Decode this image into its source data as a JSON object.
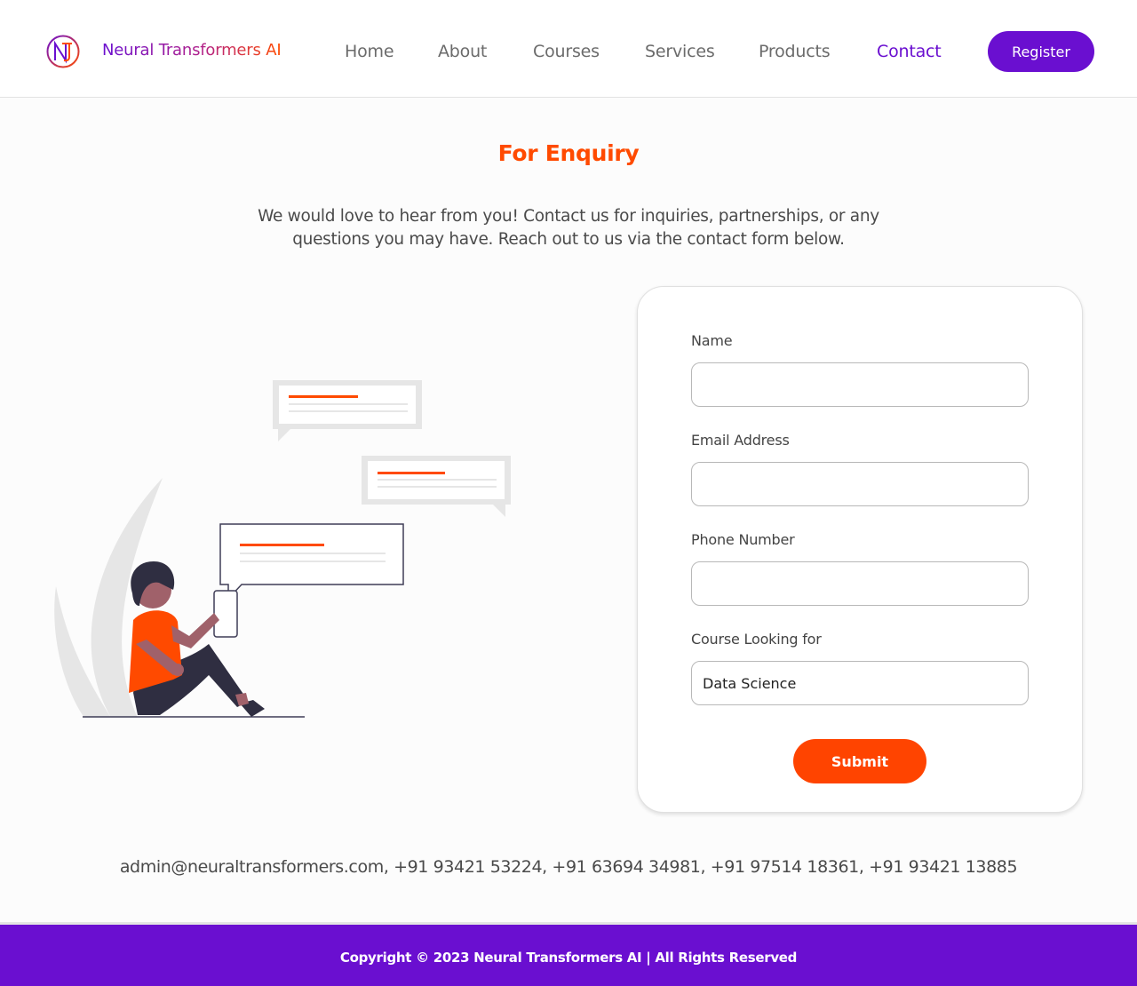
{
  "header": {
    "brand": "Neural Transformers AI",
    "nav": [
      {
        "label": "Home"
      },
      {
        "label": "About"
      },
      {
        "label": "Courses"
      },
      {
        "label": "Services"
      },
      {
        "label": "Products"
      },
      {
        "label": "Contact",
        "active": true
      }
    ],
    "register_label": "Register"
  },
  "enquiry": {
    "title": "For Enquiry",
    "description": "We would love to hear from you! Contact us for inquiries, partnerships, or any questions you may have. Reach out to us via the contact form below."
  },
  "form": {
    "name_label": "Name",
    "name_value": "",
    "email_label": "Email Address",
    "email_value": "",
    "phone_label": "Phone Number",
    "phone_value": "",
    "course_label": "Course Looking for",
    "course_value": "Data Science",
    "submit_label": "Submit"
  },
  "contact_line": "admin@neuraltransformers.com, +91 93421 53224, +91 63694 34981, +91 97514 18361, +91 93421 13885",
  "footer": {
    "copyright": "Copyright © 2023 Neural Transformers AI | All Rights Reserved"
  },
  "icons": {
    "logo": "nt-monogram-icon",
    "illustration": "person-chatting-illustration"
  },
  "colors": {
    "primary": "#6a0fd0",
    "accent": "#ff4a00"
  }
}
